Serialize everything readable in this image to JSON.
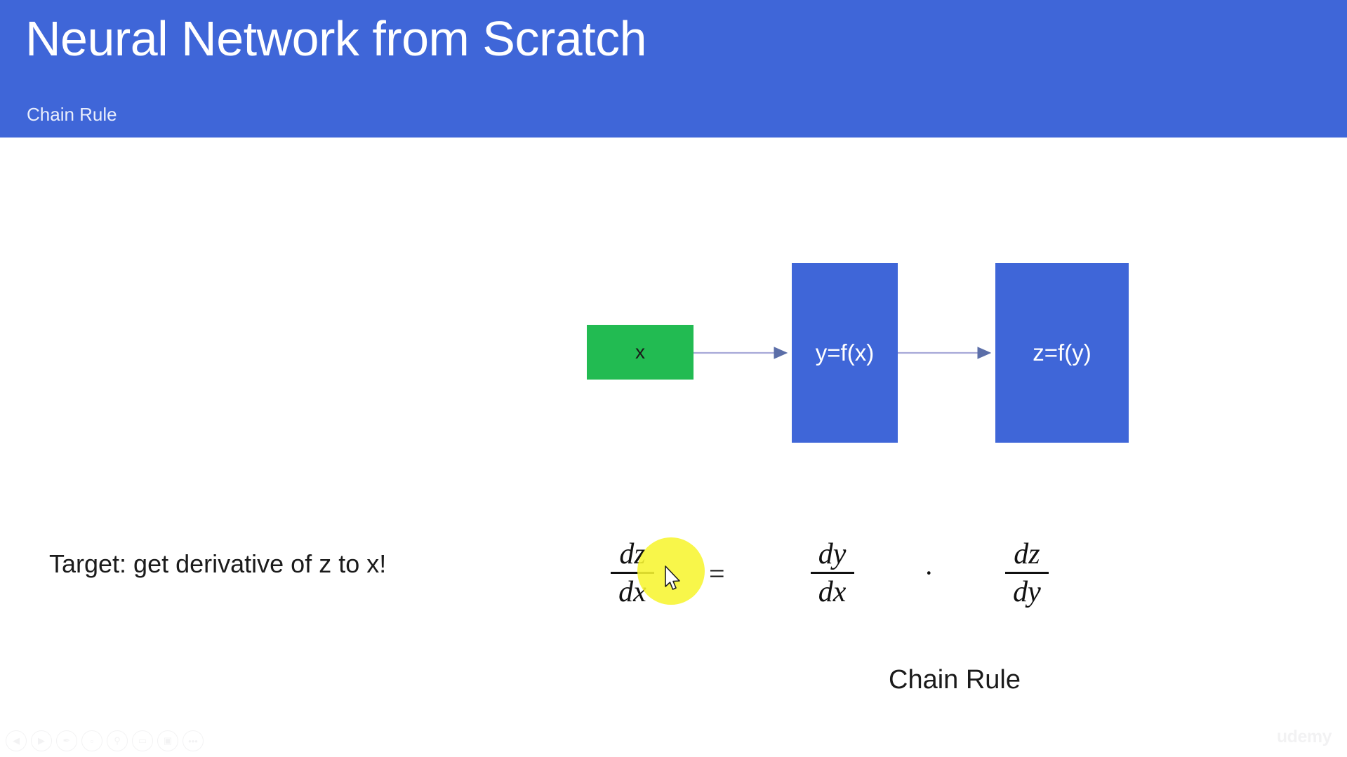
{
  "header": {
    "title": "Neural Network from Scratch",
    "subtitle": "Chain Rule",
    "background_color": "#3f66d8",
    "title_color": "#ffffff"
  },
  "diagram": {
    "nodes": [
      {
        "id": "x",
        "label": "x",
        "color": "#22bb52",
        "text_color": "#1a1a1a"
      },
      {
        "id": "y_of_x",
        "label": "y=f(x)",
        "color": "#3f66d8",
        "text_color": "#ffffff"
      },
      {
        "id": "z_of_y",
        "label": "z=f(y)",
        "color": "#3f66d8",
        "text_color": "#ffffff"
      }
    ],
    "connectors": [
      {
        "from": "x",
        "to": "y_of_x",
        "style": "arrow",
        "color": "#a7a9d8"
      },
      {
        "from": "y_of_x",
        "to": "z_of_y",
        "style": "arrow",
        "color": "#a7a9d8"
      }
    ]
  },
  "body": {
    "target_text": "Target: get derivative of z to x!",
    "chain_rule_caption": "Chain Rule"
  },
  "equation": {
    "lhs": {
      "numerator": "dz",
      "denominator": "dx"
    },
    "equals": "=",
    "rhs_first": {
      "numerator": "dy",
      "denominator": "dx"
    },
    "multiply": "·",
    "rhs_second": {
      "numerator": "dz",
      "denominator": "dy"
    },
    "plain": "dz/dx = dy/dx · dz/dy"
  },
  "annotation": {
    "highlight_color": "#f7f531",
    "highlight_shape": "circle",
    "cursor": "arrow-pointer"
  },
  "toolbar": {
    "items": [
      {
        "name": "previous-button",
        "glyph": "◀"
      },
      {
        "name": "play-button",
        "glyph": "▶"
      },
      {
        "name": "pen-tool",
        "glyph": "✒"
      },
      {
        "name": "trash-button",
        "glyph": "Ὕ1"
      },
      {
        "name": "zoom-tool",
        "glyph": "⚲"
      },
      {
        "name": "whiteboard-button",
        "glyph": "▭"
      },
      {
        "name": "camera-off-button",
        "glyph": "▣"
      },
      {
        "name": "more-options",
        "glyph": "•••"
      }
    ]
  },
  "watermark": {
    "text": "udemy"
  }
}
